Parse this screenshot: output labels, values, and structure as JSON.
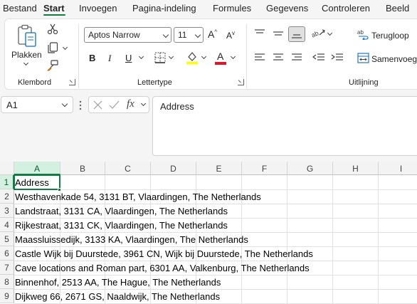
{
  "menu": {
    "tabs": [
      {
        "label": "Bestand",
        "active": false
      },
      {
        "label": "Start",
        "active": true
      },
      {
        "label": "Invoegen",
        "active": false
      },
      {
        "label": "Pagina-indeling",
        "active": false
      },
      {
        "label": "Formules",
        "active": false
      },
      {
        "label": "Gegevens",
        "active": false
      },
      {
        "label": "Controleren",
        "active": false
      },
      {
        "label": "Beeld",
        "active": false
      }
    ]
  },
  "ribbon": {
    "clipboard": {
      "paste_label": "Plakken",
      "group_label": "Klembord"
    },
    "font": {
      "name": "Aptos Narrow",
      "size": "11",
      "bold": "B",
      "italic": "I",
      "underline": "U",
      "grow": "A",
      "shrink": "A",
      "color_letter": "A",
      "group_label": "Lettertype",
      "highlight_color": "#ffff00",
      "font_color": "#e81123"
    },
    "alignment": {
      "wrap_label": "Terugloop",
      "merge_label": "Samenvoegen",
      "group_label": "Uitlijning"
    }
  },
  "formula_bar": {
    "name_box": "A1",
    "fx_label": "fx",
    "content": "Address"
  },
  "sheet": {
    "columns": [
      "A",
      "B",
      "C",
      "D",
      "E",
      "F",
      "G",
      "H",
      "I"
    ],
    "active_column": "A",
    "active_row": "1",
    "rows": [
      {
        "n": "1",
        "a": "Address"
      },
      {
        "n": "2",
        "a": "Westhavenkade 54, 3131 BT, Vlaardingen, The Netherlands"
      },
      {
        "n": "3",
        "a": "Landstraat, 3131 CA, Vlaardingen, The Netherlands"
      },
      {
        "n": "4",
        "a": "Rijkestraat, 3131 CK, Vlaardingen, The Netherlands"
      },
      {
        "n": "5",
        "a": "Maassluissedijk, 3133 KA, Vlaardingen, The Netherlands"
      },
      {
        "n": "6",
        "a": "Castle Wijk bij Duurstede, 3961 CN, Wijk bij Duurstede, The Netherlands"
      },
      {
        "n": "7",
        "a": "Cave locations and Roman part, 6301 AA, Valkenburg, The Netherlands"
      },
      {
        "n": "8",
        "a": "Binnenhof, 2513 AA, The Hague, The Netherlands"
      },
      {
        "n": "9",
        "a": "Dijkweg 66, 2671 GS, Naaldwijk, The Netherlands"
      }
    ]
  },
  "colors": {
    "accent": "#107c41"
  }
}
